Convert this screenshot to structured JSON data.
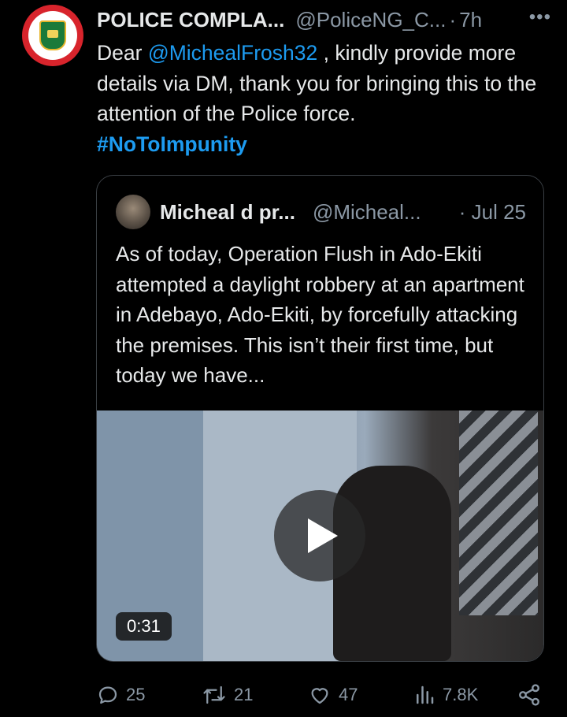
{
  "tweet": {
    "author_name": "POLICE COMPLA...",
    "author_handle": "@PoliceNG_C...",
    "separator": "·",
    "time": "7h",
    "more": "•••",
    "text_pre": "Dear ",
    "mention": "@MichealFrosh32",
    "text_post": " , kindly provide more details via DM, thank you for bringing this to the attention of the Police force.",
    "hashtag": "#NoToImpunity"
  },
  "quoted": {
    "author_name": "Micheal d pr...",
    "author_handle": "@Micheal...",
    "date": "· Jul 25",
    "text": "As of today, Operation Flush in Ado-Ekiti attempted a daylight robbery at an apartment in Adebayo, Ado-Ekiti, by forcefully attacking the premises. This isn’t their first time, but today we have...",
    "video_duration": "0:31"
  },
  "actions": {
    "replies": "25",
    "reposts": "21",
    "likes": "47",
    "views": "7.8K"
  },
  "colors": {
    "background": "#000000",
    "text": "#e7e9ea",
    "muted": "#8b98a5",
    "link": "#1d9bf0",
    "border": "#3a3f44"
  },
  "icons": [
    "reply-icon",
    "repost-icon",
    "like-icon",
    "views-icon",
    "share-icon",
    "play-icon",
    "more-icon"
  ]
}
